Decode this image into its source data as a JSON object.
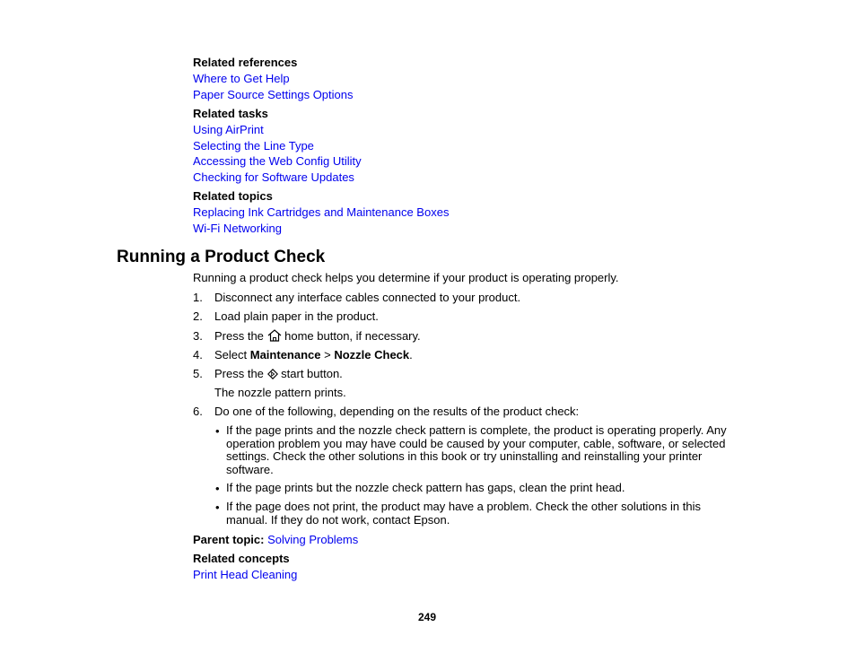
{
  "related_references": {
    "heading": "Related references",
    "links": [
      "Where to Get Help",
      "Paper Source Settings Options"
    ]
  },
  "related_tasks": {
    "heading": "Related tasks",
    "links": [
      "Using AirPrint",
      "Selecting the Line Type",
      "Accessing the Web Config Utility",
      "Checking for Software Updates"
    ]
  },
  "related_topics": {
    "heading": "Related topics",
    "links": [
      "Replacing Ink Cartridges and Maintenance Boxes",
      "Wi-Fi Networking"
    ]
  },
  "section": {
    "title": "Running a Product Check",
    "intro": "Running a product check helps you determine if your product is operating properly.",
    "steps": [
      {
        "num": "1.",
        "text": "Disconnect any interface cables connected to your product."
      },
      {
        "num": "2.",
        "text": "Load plain paper in the product."
      },
      {
        "num": "3.",
        "pre": "Press the ",
        "icon": "home-icon",
        "post": " home button, if necessary."
      },
      {
        "num": "4.",
        "pre": "Select ",
        "bold1": "Maintenance",
        "mid": " > ",
        "bold2": "Nozzle Check",
        "post": "."
      },
      {
        "num": "5.",
        "pre": "Press the ",
        "icon": "start-icon",
        "post": " start button.",
        "note": "The nozzle pattern prints."
      },
      {
        "num": "6.",
        "text": "Do one of the following, depending on the results of the product check:"
      }
    ],
    "bullets": [
      "If the page prints and the nozzle check pattern is complete, the product is operating properly. Any operation problem you may have could be caused by your computer, cable, software, or selected settings. Check the other solutions in this book or try uninstalling and reinstalling your printer software.",
      "If the page prints but the nozzle check pattern has gaps, clean the print head.",
      "If the page does not print, the product may have a problem. Check the other solutions in this manual. If they do not work, contact Epson."
    ],
    "bullet_glyph": "•",
    "parent_topic_label": "Parent topic:",
    "parent_topic_link": "Solving Problems",
    "related_concepts": {
      "heading": "Related concepts",
      "links": [
        "Print Head Cleaning"
      ]
    }
  },
  "page_number": "249",
  "colors": {
    "link": "#0000ee",
    "text": "#000000"
  }
}
